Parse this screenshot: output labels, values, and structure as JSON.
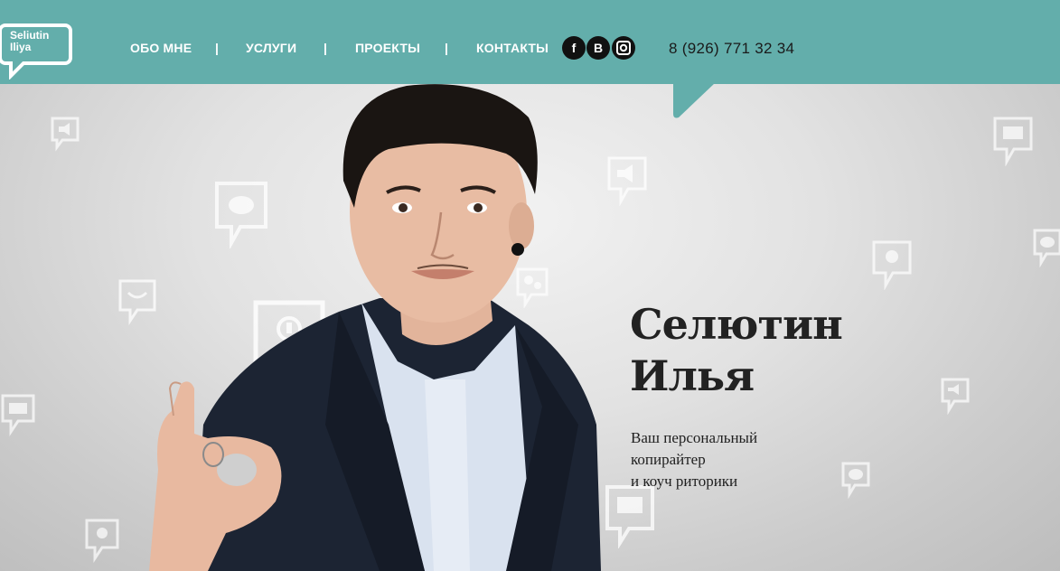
{
  "logo": {
    "line1": "Seliutin",
    "line2": "Iliya"
  },
  "nav": {
    "items": [
      {
        "label": "ОБО МНЕ"
      },
      {
        "label": "УСЛУГИ"
      },
      {
        "label": "ПРОЕКТЫ"
      },
      {
        "label": "КОНТАКТЫ"
      }
    ],
    "separator": "|"
  },
  "social": [
    {
      "icon": "facebook-icon",
      "glyph": "f"
    },
    {
      "icon": "vk-icon",
      "glyph": "B"
    },
    {
      "icon": "instagram-icon",
      "glyph": ""
    }
  ],
  "phone": "8 (926) 771 32 34",
  "hero": {
    "name_line1": "Селютин",
    "name_line2": "Илья",
    "tagline_line1": "Ваш персональный",
    "tagline_line2": "копирайтер",
    "tagline_line3": "и коуч риторики"
  },
  "colors": {
    "header": "#63aeab",
    "text_dark": "#222222",
    "social_bg": "#111111"
  }
}
